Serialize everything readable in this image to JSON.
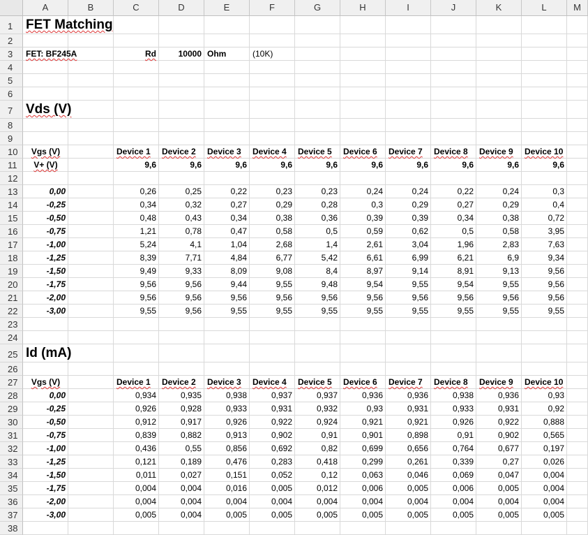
{
  "columns": [
    "A",
    "B",
    "C",
    "D",
    "E",
    "F",
    "G",
    "H",
    "I",
    "J",
    "K",
    "L",
    "M"
  ],
  "rows": [
    "1",
    "2",
    "3",
    "4",
    "5",
    "6",
    "7",
    "8",
    "9",
    "10",
    "11",
    "12",
    "13",
    "14",
    "15",
    "16",
    "17",
    "18",
    "19",
    "20",
    "21",
    "22",
    "23",
    "24",
    "25",
    "26",
    "27",
    "28",
    "29",
    "30",
    "31",
    "32",
    "33",
    "34",
    "35",
    "36",
    "37",
    "38"
  ],
  "title": "FET Matching",
  "fet": {
    "label": "FET: BF245A",
    "rd_label": "Rd",
    "rd_value": "10000",
    "rd_unit": "Ohm",
    "rd_note": "(10K)"
  },
  "vds_section": {
    "title": "Vds (V)",
    "vgs_header": "Vgs (V)",
    "vplus_label": "V+ (V)",
    "devices": [
      "Device 1",
      "Device 2",
      "Device 3",
      "Device 4",
      "Device 5",
      "Device 6",
      "Device 7",
      "Device 8",
      "Device 9",
      "Device 10"
    ],
    "vplus": [
      "9,6",
      "9,6",
      "9,6",
      "9,6",
      "9,6",
      "9,6",
      "9,6",
      "9,6",
      "9,6",
      "9,6"
    ],
    "rows": [
      {
        "vgs": "0,00",
        "values": [
          "0,26",
          "0,25",
          "0,22",
          "0,23",
          "0,23",
          "0,24",
          "0,24",
          "0,22",
          "0,24",
          "0,3"
        ]
      },
      {
        "vgs": "-0,25",
        "values": [
          "0,34",
          "0,32",
          "0,27",
          "0,29",
          "0,28",
          "0,3",
          "0,29",
          "0,27",
          "0,29",
          "0,4"
        ]
      },
      {
        "vgs": "-0,50",
        "values": [
          "0,48",
          "0,43",
          "0,34",
          "0,38",
          "0,36",
          "0,39",
          "0,39",
          "0,34",
          "0,38",
          "0,72"
        ]
      },
      {
        "vgs": "-0,75",
        "values": [
          "1,21",
          "0,78",
          "0,47",
          "0,58",
          "0,5",
          "0,59",
          "0,62",
          "0,5",
          "0,58",
          "3,95"
        ]
      },
      {
        "vgs": "-1,00",
        "values": [
          "5,24",
          "4,1",
          "1,04",
          "2,68",
          "1,4",
          "2,61",
          "3,04",
          "1,96",
          "2,83",
          "7,63"
        ]
      },
      {
        "vgs": "-1,25",
        "values": [
          "8,39",
          "7,71",
          "4,84",
          "6,77",
          "5,42",
          "6,61",
          "6,99",
          "6,21",
          "6,9",
          "9,34"
        ]
      },
      {
        "vgs": "-1,50",
        "values": [
          "9,49",
          "9,33",
          "8,09",
          "9,08",
          "8,4",
          "8,97",
          "9,14",
          "8,91",
          "9,13",
          "9,56"
        ]
      },
      {
        "vgs": "-1,75",
        "values": [
          "9,56",
          "9,56",
          "9,44",
          "9,55",
          "9,48",
          "9,54",
          "9,55",
          "9,54",
          "9,55",
          "9,56"
        ]
      },
      {
        "vgs": "-2,00",
        "values": [
          "9,56",
          "9,56",
          "9,56",
          "9,56",
          "9,56",
          "9,56",
          "9,56",
          "9,56",
          "9,56",
          "9,56"
        ]
      },
      {
        "vgs": "-3,00",
        "values": [
          "9,55",
          "9,56",
          "9,55",
          "9,55",
          "9,55",
          "9,55",
          "9,55",
          "9,55",
          "9,55",
          "9,55"
        ]
      }
    ]
  },
  "id_section": {
    "title": "Id (mA)",
    "vgs_header": "Vgs (V)",
    "devices": [
      "Device 1",
      "Device 2",
      "Device 3",
      "Device 4",
      "Device 5",
      "Device 6",
      "Device 7",
      "Device 8",
      "Device 9",
      "Device 10"
    ],
    "rows": [
      {
        "vgs": "0,00",
        "values": [
          "0,934",
          "0,935",
          "0,938",
          "0,937",
          "0,937",
          "0,936",
          "0,936",
          "0,938",
          "0,936",
          "0,93"
        ]
      },
      {
        "vgs": "-0,25",
        "values": [
          "0,926",
          "0,928",
          "0,933",
          "0,931",
          "0,932",
          "0,93",
          "0,931",
          "0,933",
          "0,931",
          "0,92"
        ]
      },
      {
        "vgs": "-0,50",
        "values": [
          "0,912",
          "0,917",
          "0,926",
          "0,922",
          "0,924",
          "0,921",
          "0,921",
          "0,926",
          "0,922",
          "0,888"
        ]
      },
      {
        "vgs": "-0,75",
        "values": [
          "0,839",
          "0,882",
          "0,913",
          "0,902",
          "0,91",
          "0,901",
          "0,898",
          "0,91",
          "0,902",
          "0,565"
        ]
      },
      {
        "vgs": "-1,00",
        "values": [
          "0,436",
          "0,55",
          "0,856",
          "0,692",
          "0,82",
          "0,699",
          "0,656",
          "0,764",
          "0,677",
          "0,197"
        ]
      },
      {
        "vgs": "-1,25",
        "values": [
          "0,121",
          "0,189",
          "0,476",
          "0,283",
          "0,418",
          "0,299",
          "0,261",
          "0,339",
          "0,27",
          "0,026"
        ]
      },
      {
        "vgs": "-1,50",
        "values": [
          "0,011",
          "0,027",
          "0,151",
          "0,052",
          "0,12",
          "0,063",
          "0,046",
          "0,069",
          "0,047",
          "0,004"
        ]
      },
      {
        "vgs": "-1,75",
        "values": [
          "0,004",
          "0,004",
          "0,016",
          "0,005",
          "0,012",
          "0,006",
          "0,005",
          "0,006",
          "0,005",
          "0,004"
        ]
      },
      {
        "vgs": "-2,00",
        "values": [
          "0,004",
          "0,004",
          "0,004",
          "0,004",
          "0,004",
          "0,004",
          "0,004",
          "0,004",
          "0,004",
          "0,004"
        ]
      },
      {
        "vgs": "-3,00",
        "values": [
          "0,005",
          "0,004",
          "0,005",
          "0,005",
          "0,005",
          "0,005",
          "0,005",
          "0,005",
          "0,005",
          "0,005"
        ]
      }
    ]
  }
}
